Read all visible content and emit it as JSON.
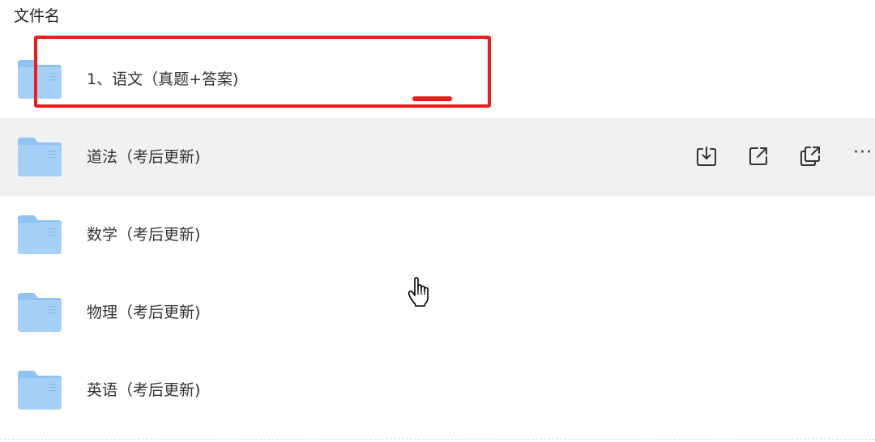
{
  "header": {
    "column_title": "文件名"
  },
  "files": [
    {
      "name": "1、语文（真题+答案)",
      "icon": "folder-icon",
      "highlighted": true
    },
    {
      "name": "道法（考后更新)",
      "icon": "folder-icon",
      "hovered": true
    },
    {
      "name": "数学（考后更新)",
      "icon": "folder-icon"
    },
    {
      "name": "物理（考后更新)",
      "icon": "folder-icon"
    },
    {
      "name": "英语（考后更新)",
      "icon": "folder-icon"
    }
  ],
  "row_actions": {
    "icons": [
      "download-icon",
      "share-icon",
      "copy-link-icon",
      "more-icon"
    ],
    "more_label": "···"
  },
  "colors": {
    "folder_blue": "#8fc2f5",
    "hover_bg": "#eff1f3",
    "annotation_red": "#ee1c1c"
  }
}
